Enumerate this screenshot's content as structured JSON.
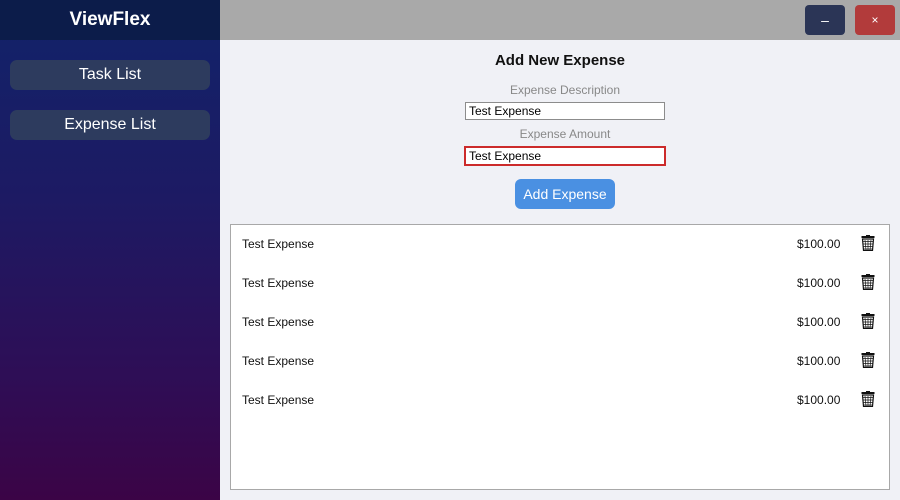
{
  "app": {
    "title": "ViewFlex"
  },
  "sidebar": {
    "items": [
      {
        "label": "Task List"
      },
      {
        "label": "Expense List"
      }
    ]
  },
  "window_controls": {
    "minimize": "–",
    "close": "×"
  },
  "form": {
    "title": "Add New Expense",
    "description_label": "Expense Description",
    "description_value": "Test Expense",
    "amount_label": "Expense Amount",
    "amount_value": "Test Expense",
    "submit_label": "Add Expense"
  },
  "expenses": [
    {
      "description": "Test Expense",
      "amount": "$100.00"
    },
    {
      "description": "Test Expense",
      "amount": "$100.00"
    },
    {
      "description": "Test Expense",
      "amount": "$100.00"
    },
    {
      "description": "Test Expense",
      "amount": "$100.00"
    },
    {
      "description": "Test Expense",
      "amount": "$100.00"
    }
  ],
  "icons": {
    "delete": "trash-icon"
  },
  "colors": {
    "accent": "#4a90e2",
    "error_border": "#cc2b2b",
    "close_button": "#b23b3b",
    "minimize_button": "#2b3556"
  }
}
